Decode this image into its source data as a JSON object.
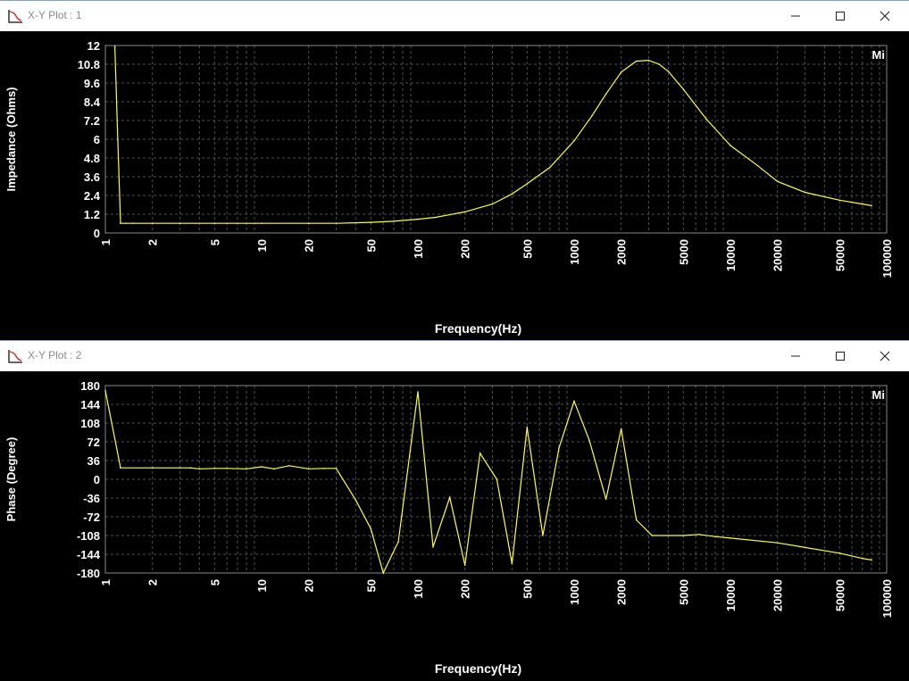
{
  "windows": [
    {
      "title": "X-Y Plot : 1"
    },
    {
      "title": "X-Y Plot : 2"
    }
  ],
  "colors": {
    "background": "#000000",
    "grid": "#666666",
    "trace": "#ffff33",
    "badge": "#ffff00"
  },
  "chart_data": [
    {
      "type": "line",
      "badge": "Mi",
      "xlabel": "Frequency(Hz)",
      "ylabel": "Impedance (Ohms)",
      "x_scale": "log",
      "xlim": [
        1,
        100000
      ],
      "ylim": [
        0,
        12
      ],
      "grid": true,
      "x_ticks": [
        "1",
        "2",
        "5",
        "10",
        "20",
        "50",
        "100",
        "200",
        "500",
        "1000",
        "2000",
        "5000",
        "10000",
        "20000",
        "50000",
        "100000"
      ],
      "y_ticks": [
        "12",
        "10.8",
        "9.6",
        "8.4",
        "7.2",
        "6",
        "4.8",
        "3.6",
        "2.4",
        "1.2",
        "0"
      ],
      "series": [
        {
          "x": [
            1.15,
            1.2,
            1.25,
            1.35,
            1.5,
            2,
            3,
            5,
            10,
            20,
            30,
            40,
            50,
            70,
            100,
            130,
            200,
            300,
            400,
            500,
            700,
            1000,
            1300,
            1600,
            2000,
            2500,
            3000,
            3500,
            4000,
            5000,
            7000,
            10000,
            15000,
            20000,
            30000,
            50000,
            70000,
            80000
          ],
          "y": [
            11.95,
            6,
            0.62,
            0.62,
            0.62,
            0.62,
            0.62,
            0.62,
            0.62,
            0.62,
            0.62,
            0.65,
            0.68,
            0.75,
            0.88,
            1.0,
            1.35,
            1.85,
            2.5,
            3.15,
            4.2,
            5.9,
            7.5,
            8.9,
            10.3,
            11.0,
            11.05,
            10.8,
            10.35,
            9.2,
            7.3,
            5.6,
            4.3,
            3.3,
            2.6,
            2.1,
            1.85,
            1.75
          ]
        }
      ]
    },
    {
      "type": "line",
      "badge": "Mi",
      "xlabel": "Frequency(Hz)",
      "ylabel": "Phase (Degree)",
      "x_scale": "log",
      "xlim": [
        1,
        100000
      ],
      "ylim": [
        -180,
        180
      ],
      "grid": true,
      "x_ticks": [
        "1",
        "2",
        "5",
        "10",
        "20",
        "50",
        "100",
        "200",
        "500",
        "1000",
        "2000",
        "5000",
        "10000",
        "20000",
        "50000",
        "100000"
      ],
      "y_ticks": [
        "180",
        "144",
        "108",
        "72",
        "36",
        "0",
        "-36",
        "-72",
        "-108",
        "-144",
        "-180"
      ],
      "series": [
        {
          "x": [
            1,
            1.25,
            2,
            3,
            3.5,
            4,
            5,
            6,
            8,
            10,
            12,
            15,
            20,
            25,
            30,
            40,
            50,
            60,
            75,
            100,
            125,
            160,
            200,
            250,
            320,
            400,
            500,
            630,
            800,
            1000,
            1250,
            1600,
            2000,
            2500,
            3150,
            4000,
            5000,
            6300,
            8000,
            10000,
            20000,
            50000,
            70000,
            80000
          ],
          "y": [
            170,
            22,
            22,
            22,
            22,
            20,
            21,
            21,
            20,
            24,
            20,
            26,
            20,
            21,
            21,
            -40,
            -95,
            -180,
            -120,
            168,
            -130,
            -35,
            -165,
            50,
            0,
            -162,
            100,
            -108,
            60,
            150,
            75,
            -38,
            97,
            -78,
            -108,
            -108,
            -108,
            -106,
            -110,
            -113,
            -122,
            -142,
            -152,
            -155
          ]
        }
      ]
    }
  ]
}
